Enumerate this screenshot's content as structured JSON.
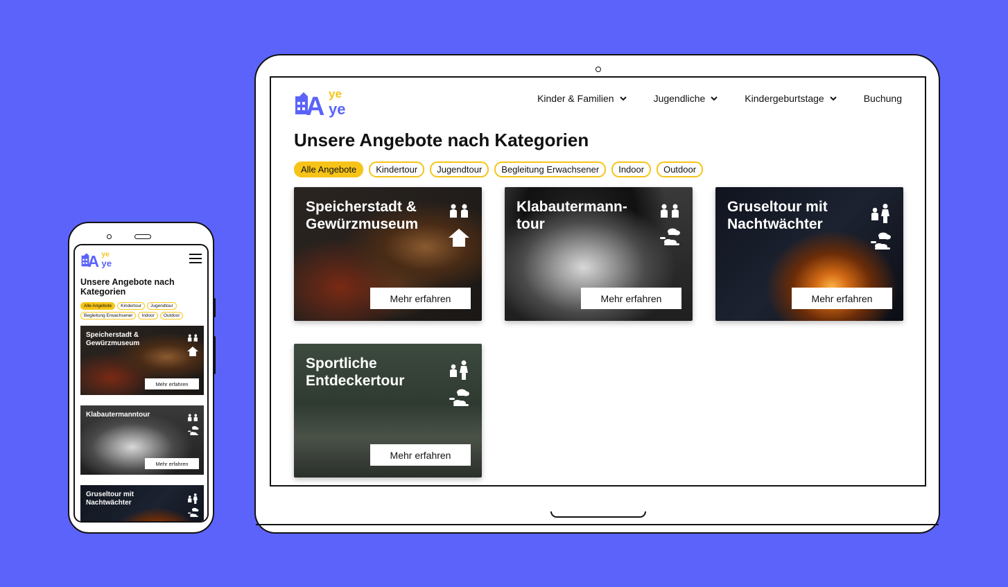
{
  "brand": {
    "logo_text_main": "A",
    "logo_text_top": "ye",
    "logo_text_bottom": "ye",
    "primary_color": "#5b63fb",
    "accent_color": "#f6c418"
  },
  "nav": {
    "items": [
      {
        "label": "Kinder & Familien",
        "has_dropdown": true
      },
      {
        "label": "Jugendliche",
        "has_dropdown": true
      },
      {
        "label": "Kindergeburtstage",
        "has_dropdown": true
      },
      {
        "label": "Buchung",
        "has_dropdown": false
      }
    ]
  },
  "page": {
    "title": "Unsere Angebote nach Kategorien"
  },
  "filters": [
    {
      "label": "Alle Angebote",
      "active": true
    },
    {
      "label": "Kindertour",
      "active": false
    },
    {
      "label": "Jugendtour",
      "active": false
    },
    {
      "label": "Begleitung Erwachsener",
      "active": false
    },
    {
      "label": "Indoor",
      "active": false
    },
    {
      "label": "Outdoor",
      "active": false
    }
  ],
  "cards": [
    {
      "title": "Speicherstadt & Gewürzmuseum",
      "button": "Mehr erfahren",
      "icons": [
        "children-icon",
        "indoor-house-icon"
      ]
    },
    {
      "title": "Klabautermann-tour",
      "button": "Mehr erfahren",
      "icons": [
        "children-icon",
        "outdoor-cloud-icon"
      ]
    },
    {
      "title": "Gruseltour mit Nachtwächter",
      "button": "Mehr erfahren",
      "icons": [
        "child-adult-icon",
        "outdoor-cloud-icon"
      ]
    },
    {
      "title": "Sportliche Entdeckertour",
      "button": "Mehr erfahren",
      "icons": [
        "child-adult-icon",
        "outdoor-cloud-icon"
      ]
    }
  ],
  "mobile": {
    "title": "Unsere Angebote nach Kategorien",
    "cards": [
      {
        "title": "Speicherstadt & Gewürzmuseum",
        "button": "Mehr erfahren"
      },
      {
        "title": "Klabautermanntour",
        "button": "Mehr erfahren"
      },
      {
        "title": "Gruseltour mit Nachtwächter",
        "button": "Mehr erfahren"
      }
    ]
  }
}
